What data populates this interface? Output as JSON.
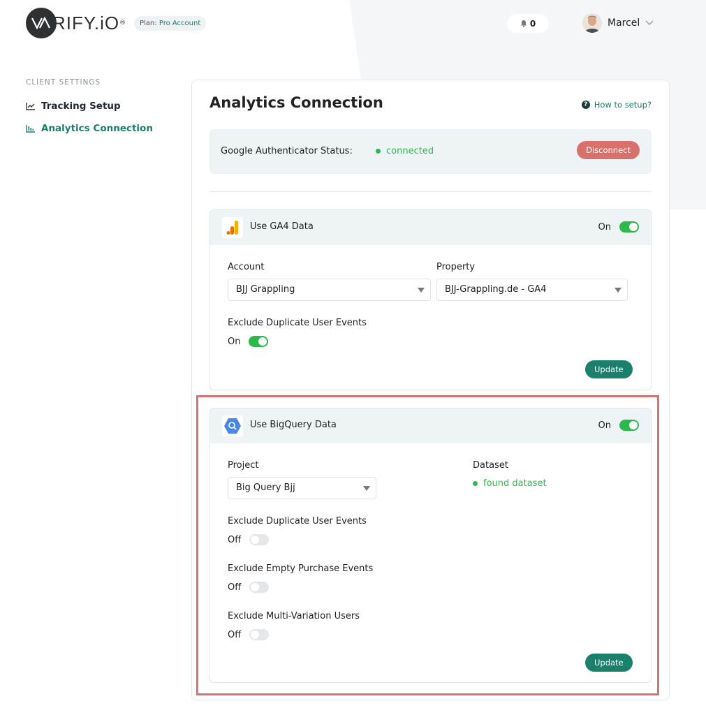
{
  "header": {
    "logo_text": "VARIFY.iO",
    "plan_prefix": "Plan:",
    "plan_value": "Pro Account",
    "notification_count": "0",
    "user_name": "Marcel"
  },
  "sidebar": {
    "heading": "CLIENT SETTINGS",
    "items": [
      {
        "label": "Tracking Setup",
        "icon": "chart-line-icon",
        "active": false
      },
      {
        "label": "Analytics Connection",
        "icon": "chart-bar-icon",
        "active": true
      }
    ]
  },
  "main": {
    "title": "Analytics Connection",
    "howto_label": "How to setup?",
    "auth": {
      "label": "Google Authenticator Status:",
      "status": "connected",
      "disconnect_label": "Disconnect"
    },
    "ga4": {
      "title": "Use GA4 Data",
      "toggle_label": "On",
      "account_label": "Account",
      "account_value": "BJJ Grappling",
      "property_label": "Property",
      "property_value": "BJJ-Grappling.de - GA4",
      "exclude_dup_label": "Exclude Duplicate User Events",
      "exclude_dup_state": "On",
      "update_label": "Update"
    },
    "bigquery": {
      "title": "Use BigQuery Data",
      "toggle_label": "On",
      "project_label": "Project",
      "project_value": "Big Query Bjj",
      "dataset_label": "Dataset",
      "dataset_status": "found dataset",
      "exclude_dup_label": "Exclude Duplicate User Events",
      "exclude_dup_state": "Off",
      "exclude_empty_label": "Exclude Empty Purchase Events",
      "exclude_empty_state": "Off",
      "exclude_multi_label": "Exclude Multi-Variation Users",
      "exclude_multi_state": "Off",
      "update_label": "Update"
    }
  },
  "colors": {
    "accent": "#1a7f6b",
    "success": "#2db84c",
    "danger": "#d9706c",
    "highlight": "#d47373"
  }
}
